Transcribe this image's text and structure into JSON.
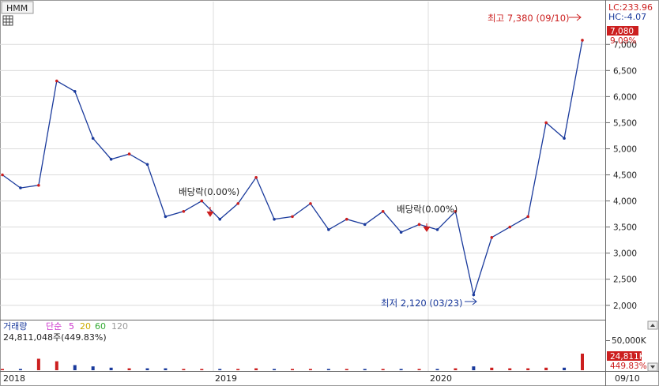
{
  "header": {
    "ticker": "HMM",
    "lc_label": "LC:233.96",
    "hc_label": "HC:-4.07",
    "grid_icon": "grid-icon"
  },
  "price_panel": {
    "last_price_label": "7,080",
    "last_change_label": "9.09%",
    "annotations": {
      "high": "최고 7,380 (09/10)",
      "low": "최저 2,120 (03/23)",
      "dividend1": "배당락(0.00%)",
      "dividend2": "배당락(0.00%)"
    }
  },
  "volume_panel": {
    "legend": {
      "label": "거래량",
      "ma_type": "단순",
      "ma5": "5",
      "ma20": "20",
      "ma60": "60",
      "ma120": "120"
    },
    "volume_text": "24,811,048주(449.83%)",
    "axis_tick": "50,000K",
    "last_volume_label": "24,811K",
    "last_volume_pct": "449.83%"
  },
  "x_axis": {
    "labels": [
      "2018",
      "2019",
      "2020"
    ],
    "right_label": "09/10"
  },
  "colors": {
    "up": "#cc1f1f",
    "down": "#1a3a9c",
    "grid": "#dcdcdc",
    "ma5": "#cc33cc",
    "ma20": "#ccaa00",
    "ma60": "#33aa33",
    "ma120": "#999999"
  },
  "chart_data": [
    {
      "type": "line",
      "title": "HMM",
      "x": [
        "2018-01",
        "2018-02",
        "2018-03",
        "2018-04",
        "2018-05",
        "2018-06",
        "2018-07",
        "2018-08",
        "2018-09",
        "2018-10",
        "2018-11",
        "2018-12",
        "2019-01",
        "2019-02",
        "2019-03",
        "2019-04",
        "2019-05",
        "2019-06",
        "2019-07",
        "2019-08",
        "2019-09",
        "2019-10",
        "2019-11",
        "2019-12",
        "2020-01",
        "2020-02",
        "2020-03",
        "2020-04",
        "2020-05",
        "2020-06",
        "2020-07",
        "2020-08",
        "2020-09"
      ],
      "series": [
        {
          "values": [
            4500,
            4250,
            4300,
            6300,
            6100,
            5200,
            4800,
            4900,
            4700,
            3700,
            3800,
            4000,
            3650,
            3950,
            4450,
            3650,
            3700,
            3950,
            3450,
            3650,
            3550,
            3800,
            3400,
            3550,
            3450,
            3800,
            2200,
            3300,
            3500,
            3700,
            5500,
            5200,
            7080
          ]
        }
      ],
      "ylim": [
        1800,
        7700
      ],
      "yticks": [
        2000,
        2500,
        3000,
        3500,
        4000,
        4500,
        5000,
        5500,
        6000,
        6500,
        7000
      ],
      "annotations": [
        {
          "label": "최고 7,380 (09/10)",
          "x": "2020-09",
          "y": 7380
        },
        {
          "label": "최저 2,120 (03/23)",
          "x": "2020-03",
          "y": 2120
        }
      ]
    },
    {
      "type": "bar",
      "title": "거래량",
      "values": [
        2,
        2,
        18,
        14,
        8,
        6,
        4,
        3,
        3,
        3,
        2,
        2,
        2,
        2,
        3,
        2,
        2,
        2,
        2,
        2,
        2,
        2,
        2,
        2,
        2,
        3,
        6,
        4,
        3,
        3,
        4,
        4,
        26
      ],
      "ylim": [
        0,
        55000
      ],
      "yticks": [
        50000
      ]
    }
  ]
}
